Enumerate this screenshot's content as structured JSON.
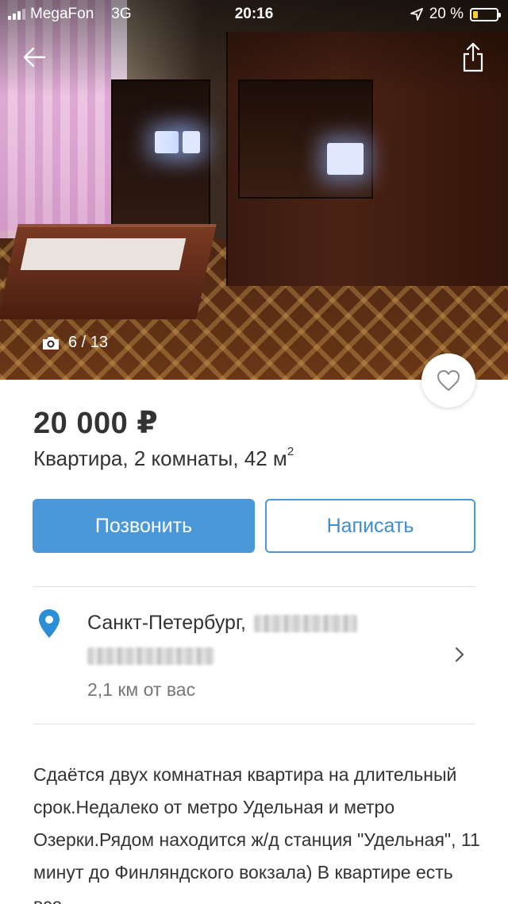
{
  "status_bar": {
    "carrier": "MegaFon",
    "network": "3G",
    "time": "20:16",
    "battery": "20 %",
    "battery_level": 0.2
  },
  "gallery": {
    "counter": "6 / 13"
  },
  "listing": {
    "price": "20 000 ₽",
    "title": "Квартира, 2 комнаты, 42 м",
    "title_superscript": "2"
  },
  "actions": {
    "call_label": "Позвонить",
    "write_label": "Написать"
  },
  "location": {
    "city": "Санкт-Петербург,",
    "distance": "2,1  км от вас"
  },
  "description": {
    "text": "Сдаётся двух комнатная квартира на длительный срок.Недалеко от метро Удельная и метро Озерки.Рядом находится ж/д станция \"Удельная\", 11 минут до Финляндского вокзала) В квартире есть все"
  },
  "colors": {
    "accent": "#4a98d8",
    "pin": "#2a8fd6",
    "battery": "#f7cf2d"
  },
  "icons": {
    "back": "arrow-left-icon",
    "share": "share-icon",
    "camera": "camera-icon",
    "favorite": "heart-icon",
    "location": "map-pin-icon",
    "chevron": "chevron-right-icon"
  }
}
